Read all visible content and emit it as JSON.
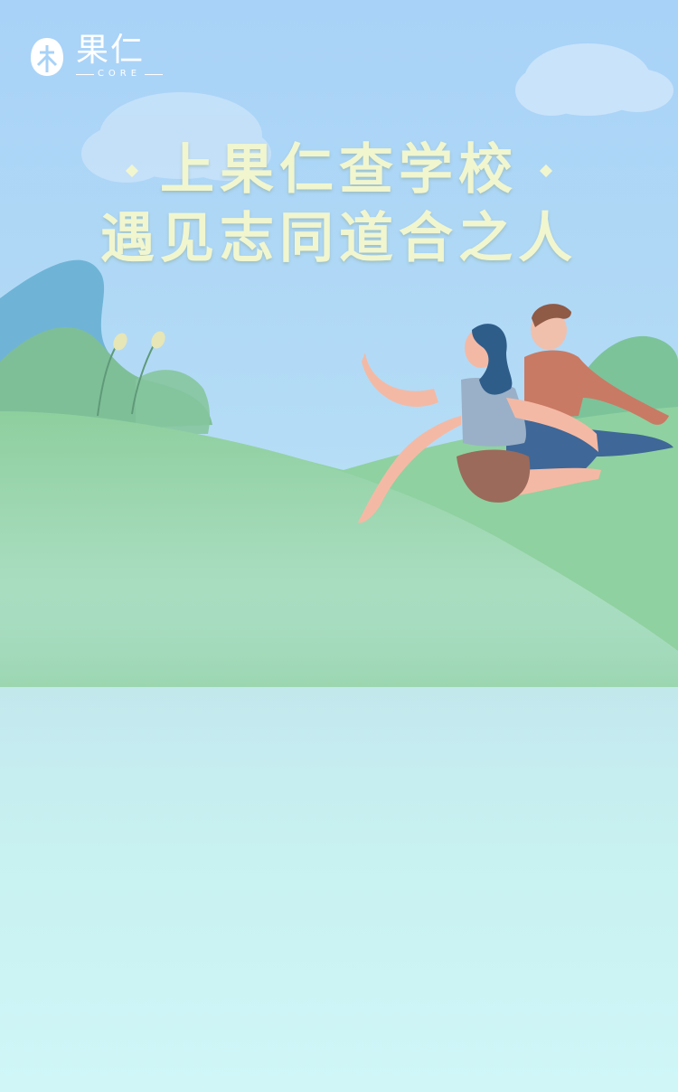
{
  "logo": {
    "name": "果仁",
    "sub": "CORE"
  },
  "headline": {
    "line1": "上果仁查学校",
    "line2": "遇见志同道合之人"
  },
  "icons": [
    "logo-mark-icon",
    "cloud-icon",
    "bush-icon",
    "couple-illustration"
  ],
  "colors": {
    "sky": "#a8d2f7",
    "grass": "#8ecf9e",
    "title": "#f1f6cf"
  }
}
